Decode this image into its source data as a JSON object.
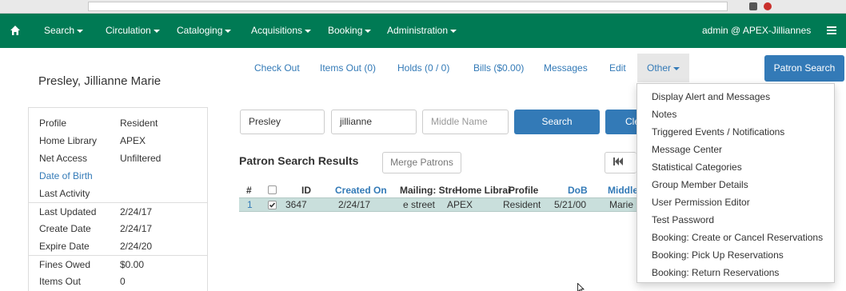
{
  "navbar": {
    "items": [
      {
        "label": "Search",
        "dropdown": true
      },
      {
        "label": "Circulation",
        "dropdown": true
      },
      {
        "label": "Cataloging",
        "dropdown": true
      },
      {
        "label": "Acquisitions",
        "dropdown": true
      },
      {
        "label": "Booking",
        "dropdown": true
      },
      {
        "label": "Administration",
        "dropdown": true
      }
    ],
    "user": "admin @ APEX-Jilliannes",
    "color": "#007a54"
  },
  "patron": {
    "name": "Presley, Jillianne Marie",
    "summary": [
      {
        "key": "Profile",
        "value": "Resident"
      },
      {
        "key": "Home Library",
        "value": "APEX"
      },
      {
        "key": "Net Access",
        "value": "Unfiltered"
      },
      {
        "key": "Date of Birth",
        "value": ""
      },
      {
        "key": "Last Activity",
        "value": ""
      },
      {
        "key": "Last Updated",
        "value": "2/24/17"
      },
      {
        "key": "Create Date",
        "value": "2/24/17"
      },
      {
        "key": "Expire Date",
        "value": "2/24/20"
      },
      {
        "key": "Fines Owed",
        "value": "$0.00"
      },
      {
        "key": "Items Out",
        "value": "0"
      }
    ]
  },
  "tabs": {
    "check_out": "Check Out",
    "items_out": "Items Out (0)",
    "holds": "Holds (0 / 0)",
    "bills": "Bills ($0.00)",
    "messages": "Messages",
    "edit": "Edit",
    "other": "Other",
    "patron_search": "Patron Search"
  },
  "search": {
    "last_name": "Presley",
    "first_name": "jillianne",
    "middle_placeholder": "Middle Name",
    "search_label": "Search",
    "clear_label": "Cle"
  },
  "results": {
    "title": "Patron Search Results",
    "merge_label": "Merge Patrons",
    "columns": [
      "#",
      "",
      "ID",
      "Created On",
      "Mailing: Stre",
      "Home Librai",
      "Profile",
      "DoB",
      "Middle"
    ],
    "rows": [
      {
        "num": "1",
        "checked": true,
        "id": "3647",
        "created": "2/24/17",
        "street": "e street",
        "library": "APEX",
        "profile": "Resident",
        "dob": "5/21/00",
        "middle": "Marie"
      }
    ]
  },
  "other_menu": {
    "items": [
      "Display Alert and Messages",
      "Notes",
      "Triggered Events / Notifications",
      "Message Center",
      "Statistical Categories",
      "Group Member Details",
      "User Permission Editor",
      "Test Password",
      "Booking: Create or Cancel Reservations",
      "Booking: Pick Up Reservations",
      "Booking: Return Reservations"
    ]
  }
}
